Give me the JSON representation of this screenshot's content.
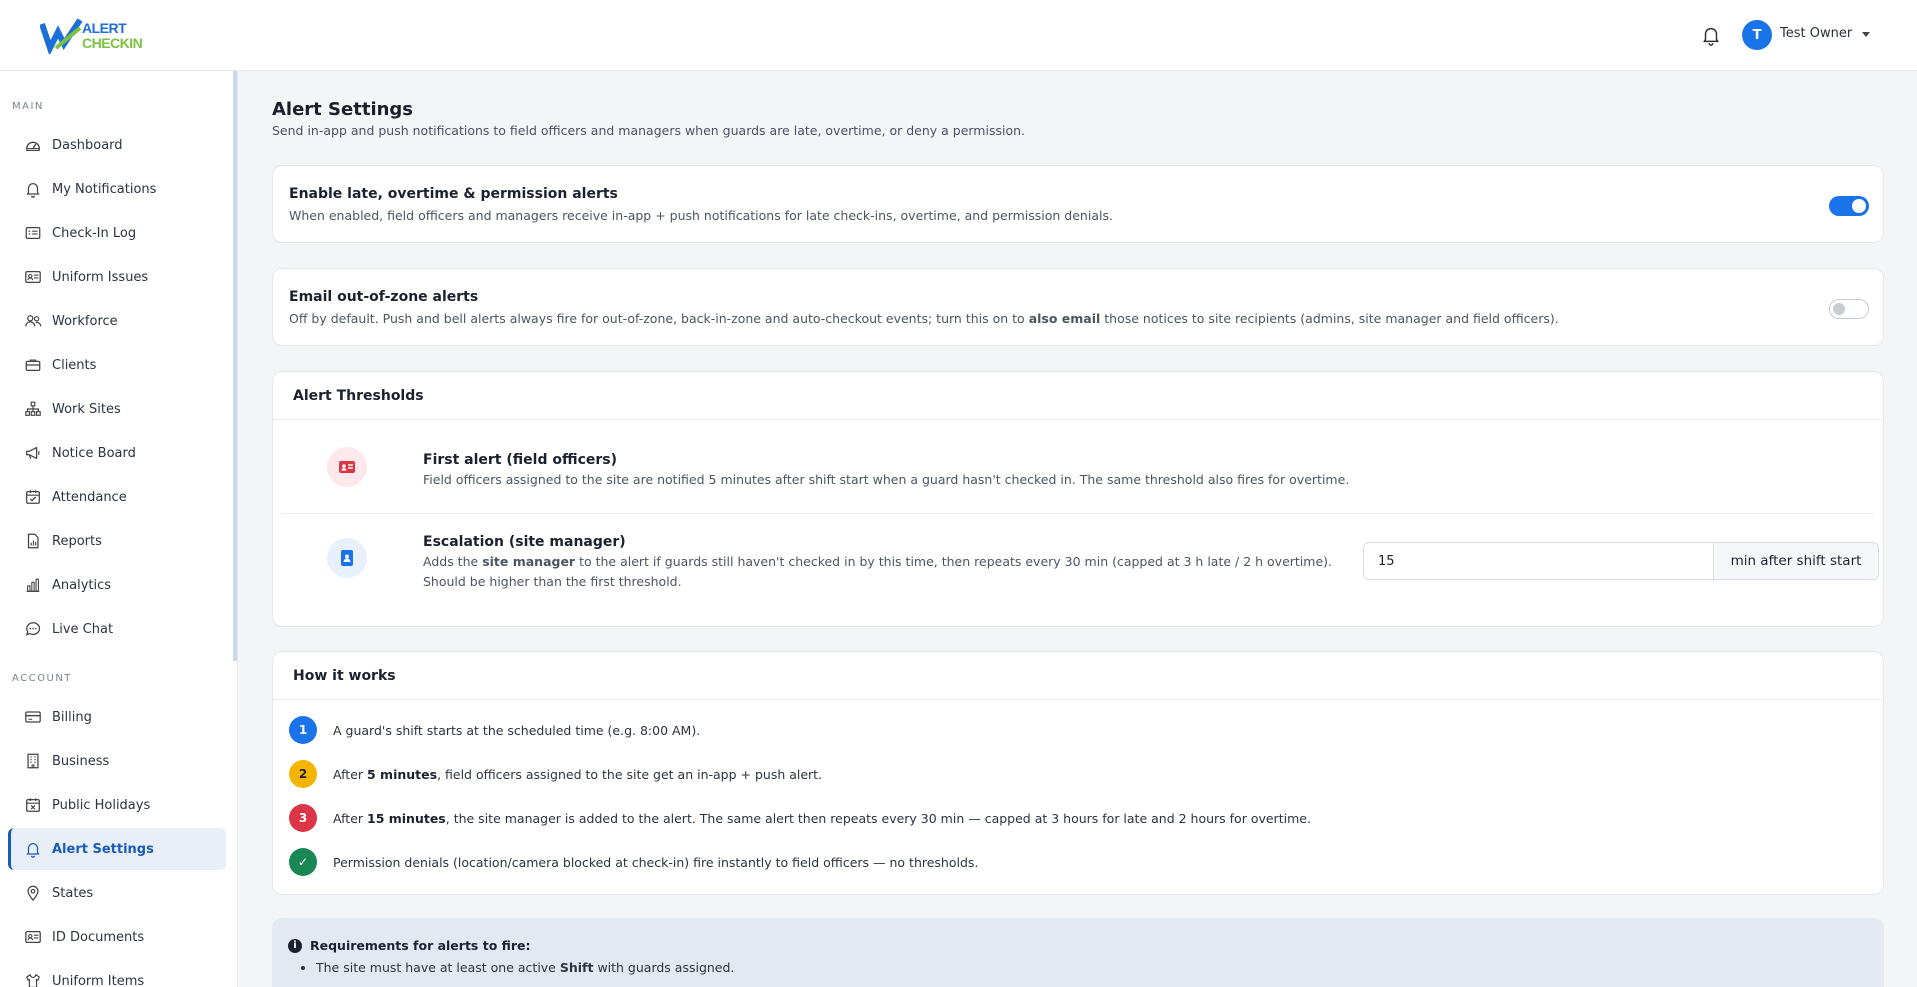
{
  "brand": {
    "line1": "ALERT",
    "line2": "CHECKIN",
    "primary": "#1d6fd8",
    "secondary": "#7cc242"
  },
  "header": {
    "avatar_initial": "T",
    "user_name": "Test Owner"
  },
  "sidebar": {
    "main_label": "MAIN",
    "main_items": [
      {
        "label": "Dashboard",
        "icon": "dashboard-icon"
      },
      {
        "label": "My Notifications",
        "icon": "bell-icon"
      },
      {
        "label": "Check-In Log",
        "icon": "log-icon"
      },
      {
        "label": "Uniform Issues",
        "icon": "id-card-icon"
      },
      {
        "label": "Workforce",
        "icon": "users-icon"
      },
      {
        "label": "Clients",
        "icon": "briefcase-icon"
      },
      {
        "label": "Work Sites",
        "icon": "sitemap-icon"
      },
      {
        "label": "Notice Board",
        "icon": "megaphone-icon"
      },
      {
        "label": "Attendance",
        "icon": "calendar-check-icon"
      },
      {
        "label": "Reports",
        "icon": "report-icon"
      },
      {
        "label": "Analytics",
        "icon": "bar-chart-icon"
      },
      {
        "label": "Live Chat",
        "icon": "chat-icon"
      }
    ],
    "account_label": "ACCOUNT",
    "account_items": [
      {
        "label": "Billing",
        "icon": "credit-card-icon"
      },
      {
        "label": "Business",
        "icon": "building-icon"
      },
      {
        "label": "Public Holidays",
        "icon": "calendar-x-icon"
      },
      {
        "label": "Alert Settings",
        "icon": "bell-icon",
        "active": true
      },
      {
        "label": "States",
        "icon": "map-pin-icon"
      },
      {
        "label": "ID Documents",
        "icon": "id-card-icon"
      },
      {
        "label": "Uniform Items",
        "icon": "shirt-icon"
      }
    ]
  },
  "page": {
    "title": "Alert Settings",
    "subtitle": "Send in-app and push notifications to field officers and managers when guards are late, overtime, or deny a permission."
  },
  "toggles": [
    {
      "title": "Enable late, overtime & permission alerts",
      "desc": "When enabled, field officers and managers receive in-app + push notifications for late check-ins, overtime, and permission denials.",
      "on": true
    },
    {
      "title": "Email out-of-zone alerts",
      "desc_before": "Off by default. Push and bell alerts always fire for out-of-zone, back-in-zone and auto-checkout events; turn this on to ",
      "desc_bold": "also email",
      "desc_after": " those notices to site recipients (admins, site manager and field officers).",
      "on": false
    }
  ],
  "thresholds": {
    "heading": "Alert Thresholds",
    "first": {
      "title": "First alert (field officers)",
      "desc": "Field officers assigned to the site are notified 5 minutes after shift start when a guard hasn't checked in. The same threshold also fires for overtime."
    },
    "escalation": {
      "title": "Escalation (site manager)",
      "desc_before": "Adds the ",
      "desc_bold": "site manager",
      "desc_after": " to the alert if guards still haven't checked in by this time, then repeats every 30 min (capped at 3 h late / 2 h overtime).",
      "desc_line2": "Should be higher than the first threshold.",
      "value": "15",
      "suffix": "min after shift start"
    }
  },
  "how": {
    "heading": "How it works",
    "steps": [
      {
        "num": "1",
        "color": "#1a73e8",
        "before": "A guard's shift starts at the scheduled time (e.g. 8:00 AM).",
        "bold": "",
        "after": ""
      },
      {
        "num": "2",
        "color": "#f5b400",
        "before": "After ",
        "bold": "5 minutes",
        "after": ", field officers assigned to the site get an in-app + push alert."
      },
      {
        "num": "3",
        "color": "#dc3545",
        "before": "After ",
        "bold": "15 minutes",
        "after": ", the site manager is added to the alert. The same alert then repeats every 30 min — capped at 3 hours for late and 2 hours for overtime."
      },
      {
        "num": "✓",
        "color": "#198754",
        "before": "Permission denials (location/camera blocked at check-in) fire instantly to field officers — no thresholds.",
        "bold": "",
        "after": ""
      }
    ]
  },
  "requirements": {
    "heading": "Requirements for alerts to fire:",
    "item1_before": "The site must have at least one active ",
    "item1_bold": "Shift",
    "item1_after": " with guards assigned."
  }
}
